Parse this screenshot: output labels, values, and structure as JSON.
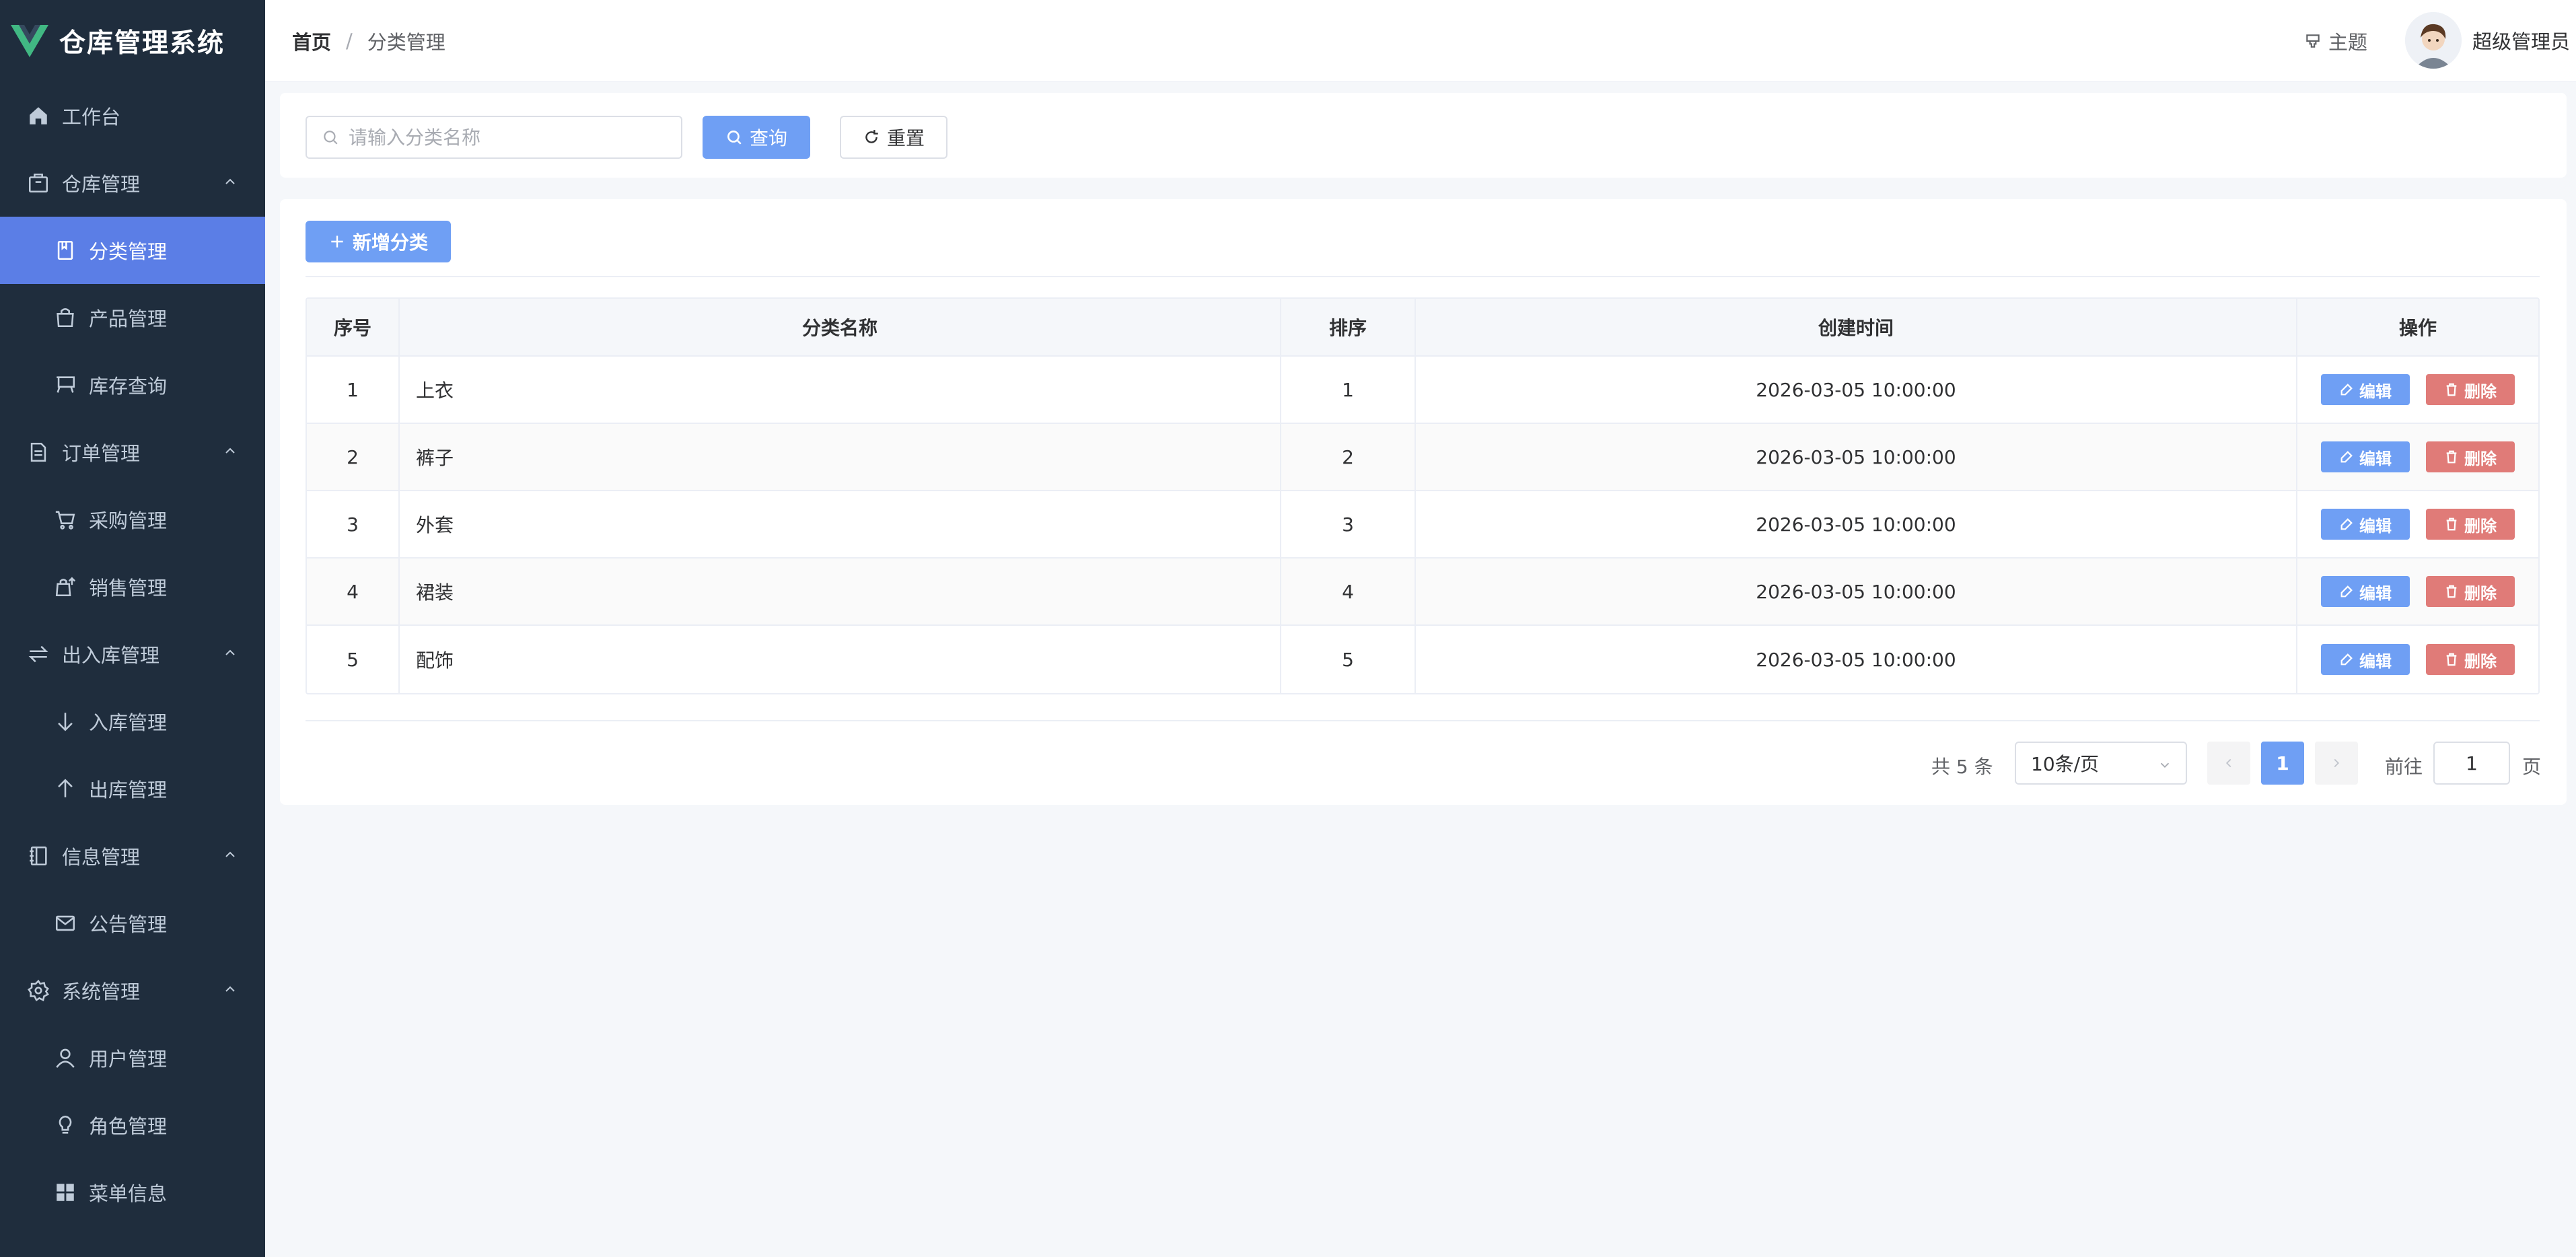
{
  "app": {
    "title": "仓库管理系统",
    "colors": {
      "sidebar_bg": "#1f2d3d",
      "active": "#5b7ee6",
      "primary": "#6f9ff4",
      "danger": "#e07b78",
      "logo": "#41b883"
    }
  },
  "sidebar": {
    "items": [
      {
        "label": "工作台",
        "icon": "home-icon",
        "level": "top"
      },
      {
        "label": "仓库管理",
        "icon": "box-icon",
        "level": "group",
        "expanded": true
      },
      {
        "label": "分类管理",
        "icon": "bookmark-icon",
        "level": "sub",
        "active": true
      },
      {
        "label": "产品管理",
        "icon": "bag-icon",
        "level": "sub"
      },
      {
        "label": "库存查询",
        "icon": "cart-icon",
        "level": "sub"
      },
      {
        "label": "订单管理",
        "icon": "document-icon",
        "level": "group",
        "expanded": true
      },
      {
        "label": "采购管理",
        "icon": "shopping-cart-icon",
        "level": "sub"
      },
      {
        "label": "销售管理",
        "icon": "sell-icon",
        "level": "sub"
      },
      {
        "label": "出入库管理",
        "icon": "switch-icon",
        "level": "group",
        "expanded": true
      },
      {
        "label": "入库管理",
        "icon": "arrow-down-icon",
        "level": "sub"
      },
      {
        "label": "出库管理",
        "icon": "arrow-up-icon",
        "level": "sub"
      },
      {
        "label": "信息管理",
        "icon": "notebook-icon",
        "level": "group",
        "expanded": true
      },
      {
        "label": "公告管理",
        "icon": "message-icon",
        "level": "sub"
      },
      {
        "label": "系统管理",
        "icon": "gear-icon",
        "level": "group",
        "expanded": true
      },
      {
        "label": "用户管理",
        "icon": "user-icon",
        "level": "sub"
      },
      {
        "label": "角色管理",
        "icon": "bulb-icon",
        "level": "sub"
      },
      {
        "label": "菜单信息",
        "icon": "menu-grid-icon",
        "level": "sub"
      }
    ]
  },
  "header": {
    "breadcrumb": {
      "home": "首页",
      "separator": "/",
      "current": "分类管理"
    },
    "theme_label": "主题",
    "user_name": "超级管理员"
  },
  "search": {
    "placeholder": "请输入分类名称",
    "value": "",
    "query_label": "查询",
    "reset_label": "重置"
  },
  "toolbar": {
    "add_label": "新增分类"
  },
  "table": {
    "columns": [
      "序号",
      "分类名称",
      "排序",
      "创建时间",
      "操作"
    ],
    "rows": [
      {
        "idx": "1",
        "name": "上衣",
        "sort": "1",
        "time": "2026-03-05 10:00:00"
      },
      {
        "idx": "2",
        "name": "裤子",
        "sort": "2",
        "time": "2026-03-05 10:00:00"
      },
      {
        "idx": "3",
        "name": "外套",
        "sort": "3",
        "time": "2026-03-05 10:00:00"
      },
      {
        "idx": "4",
        "name": "裙装",
        "sort": "4",
        "time": "2026-03-05 10:00:00"
      },
      {
        "idx": "5",
        "name": "配饰",
        "sort": "5",
        "time": "2026-03-05 10:00:00"
      }
    ],
    "edit_label": "编辑",
    "delete_label": "删除"
  },
  "pagination": {
    "total_text": "共 5 条",
    "page_size": "10条/页",
    "current_page": "1",
    "goto_prefix": "前往",
    "goto_value": "1",
    "goto_suffix": "页"
  }
}
